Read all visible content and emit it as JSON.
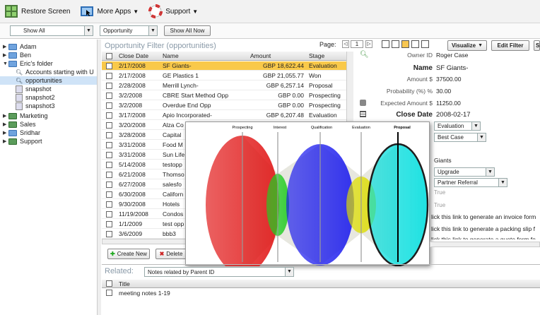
{
  "toolbar": {
    "restore_label": "Restore Screen",
    "more_apps_label": "More Apps",
    "support_label": "Support"
  },
  "filterbar": {
    "view_select": "Show All",
    "object_select": "Opportunity",
    "show_all_button": "Show All Now"
  },
  "sidebar": {
    "items": [
      {
        "label": "Adam",
        "kind": "folder",
        "level": 0,
        "expanded": false
      },
      {
        "label": "Ben",
        "kind": "folder",
        "level": 0,
        "expanded": false
      },
      {
        "label": "Eric's folder",
        "kind": "folder",
        "level": 0,
        "expanded": true
      },
      {
        "label": "Accounts starting with U",
        "kind": "search",
        "level": 1
      },
      {
        "label": "opportunities",
        "kind": "search",
        "level": 1,
        "selected": true
      },
      {
        "label": "snapshot",
        "kind": "doc",
        "level": 1
      },
      {
        "label": "snapshot2",
        "kind": "doc",
        "level": 1
      },
      {
        "label": "snapshot3",
        "kind": "doc",
        "level": 1
      },
      {
        "label": "Marketing",
        "kind": "folder2",
        "level": 0,
        "expanded": false
      },
      {
        "label": "Sales",
        "kind": "folder2",
        "level": 0,
        "expanded": false
      },
      {
        "label": "Sridhar",
        "kind": "folder",
        "level": 0,
        "expanded": false
      },
      {
        "label": "Support",
        "kind": "folder2",
        "level": 0,
        "expanded": false
      }
    ]
  },
  "grid": {
    "title": "Opportunity Filter (opportunities)",
    "page_label": "Page:",
    "page_value": "1",
    "visualize_label": "Visualize",
    "edit_filter_label": "Edit Filter",
    "save_label": "Sa",
    "columns": [
      "Close Date",
      "Name",
      "Amount",
      "Stage"
    ],
    "rows": [
      {
        "date": "2/17/2008",
        "name": "SF Giants-",
        "amount": "GBP 18,622.44",
        "stage": "Evaluation",
        "highlight": true
      },
      {
        "date": "2/17/2008",
        "name": "GE Plastics 1",
        "amount": "GBP 21,055.77",
        "stage": "Won"
      },
      {
        "date": "2/28/2008",
        "name": "Merrill Lynch-",
        "amount": "GBP 6,257.14",
        "stage": "Proposal"
      },
      {
        "date": "3/2/2008",
        "name": "CBRE Start Method Opp",
        "amount": "GBP 0.00",
        "stage": "Prospecting"
      },
      {
        "date": "3/2/2008",
        "name": "Overdue End Opp",
        "amount": "GBP 0.00",
        "stage": "Prospecting"
      },
      {
        "date": "3/17/2008",
        "name": "Apio Incorporated-",
        "amount": "GBP 6,207.48",
        "stage": "Evaluation"
      },
      {
        "date": "3/20/2008",
        "name": "Alza Co",
        "amount": "",
        "stage": ""
      },
      {
        "date": "3/28/2008",
        "name": "Capital",
        "amount": "",
        "stage": ""
      },
      {
        "date": "3/31/2008",
        "name": "Food M",
        "amount": "",
        "stage": ""
      },
      {
        "date": "3/31/2008",
        "name": "Sun Life",
        "amount": "",
        "stage": ""
      },
      {
        "date": "5/14/2008",
        "name": "testopp",
        "amount": "",
        "stage": ""
      },
      {
        "date": "6/21/2008",
        "name": "Thomso",
        "amount": "",
        "stage": ""
      },
      {
        "date": "6/27/2008",
        "name": "salesfo",
        "amount": "",
        "stage": ""
      },
      {
        "date": "6/30/2008",
        "name": "Californ",
        "amount": "",
        "stage": ""
      },
      {
        "date": "9/30/2008",
        "name": "Hotels",
        "amount": "",
        "stage": ""
      },
      {
        "date": "11/19/2008",
        "name": "Condos",
        "amount": "",
        "stage": ""
      },
      {
        "date": "1/1/2009",
        "name": "test opp",
        "amount": "",
        "stage": ""
      },
      {
        "date": "3/6/2009",
        "name": "bbb3",
        "amount": "",
        "stage": ""
      }
    ],
    "create_new_label": "Create New",
    "delete_label": "Delete"
  },
  "details": {
    "rows": [
      {
        "label": "Owner ID",
        "value": "Roger Case",
        "bold": false
      },
      {
        "label": "Name",
        "value": "SF Giants-",
        "bold": true
      },
      {
        "label": "Amount $",
        "value": "37500.00",
        "bold": false
      },
      {
        "label": "Probability (%) %",
        "value": "30.00",
        "bold": false
      },
      {
        "label": "Expected Amount $",
        "value": "11250.00",
        "bold": false
      },
      {
        "label": "Close Date",
        "value": "2008-02-17",
        "bold": true
      }
    ],
    "stage_select": "Evaluation",
    "forecast_select": "Best Case",
    "account_value": "Giants",
    "type_select": "Upgrade",
    "lead_source_select": "Partner Referral",
    "bool1": "True",
    "bool2": "True",
    "link1": "lick this link to generate an invoice form",
    "link2": "lick this link to generate a packing slip f",
    "link3": "lick this link to generate a quote form fo"
  },
  "related": {
    "label": "Related:",
    "select": "Notes related by Parent ID",
    "column": "Title",
    "rows": [
      "meeting notes 1-19"
    ]
  },
  "funnel": {
    "stages": [
      "Prospecting",
      "Interest",
      "Qualification",
      "Evaluation",
      "Proposal"
    ],
    "colors": [
      "#e01010",
      "#22cc22",
      "#1a1aee",
      "#dddd00",
      "#00dddd"
    ]
  }
}
